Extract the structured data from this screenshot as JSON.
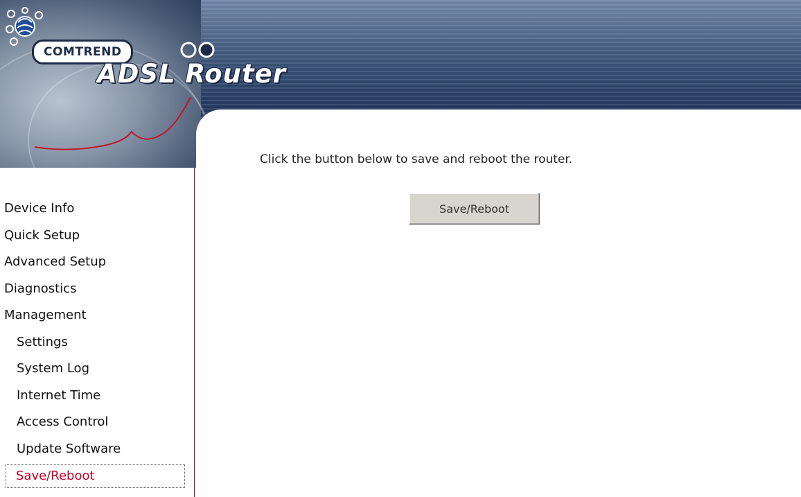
{
  "header": {
    "brand": "COMTREND",
    "product": "ADSL Router"
  },
  "main": {
    "instruction": "Click the button below to save and reboot the router.",
    "save_reboot_button": "Save/Reboot"
  },
  "sidebar": {
    "items": [
      {
        "label": "Device Info",
        "level": "top"
      },
      {
        "label": "Quick Setup",
        "level": "top"
      },
      {
        "label": "Advanced Setup",
        "level": "top"
      },
      {
        "label": "Diagnostics",
        "level": "top"
      },
      {
        "label": "Management",
        "level": "top"
      },
      {
        "label": "Settings",
        "level": "sub"
      },
      {
        "label": "System Log",
        "level": "sub"
      },
      {
        "label": "Internet Time",
        "level": "sub"
      },
      {
        "label": "Access Control",
        "level": "sub"
      },
      {
        "label": "Update Software",
        "level": "sub"
      },
      {
        "label": "Save/Reboot",
        "level": "sub",
        "active": true
      }
    ]
  },
  "colors": {
    "banner": "#2b4166",
    "active_link": "#c4002a",
    "sidebar_border": "#8a1c2e",
    "button_bg": "#d8d5cf"
  }
}
